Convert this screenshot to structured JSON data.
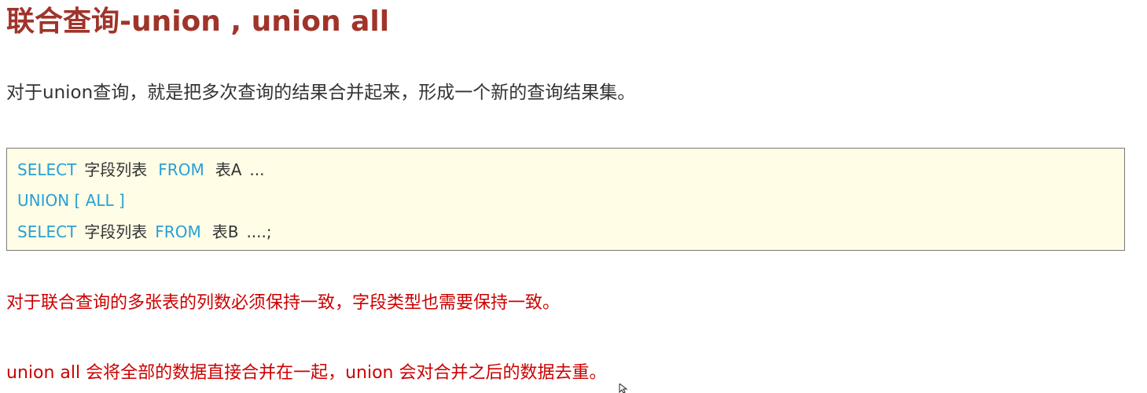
{
  "title": "联合查询-union , union all",
  "intro": "对于union查询，就是把多次查询的结果合并起来，形成一个新的查询结果集。",
  "code": {
    "line1": {
      "kw_select": "SELECT",
      "fields": "字段列表",
      "kw_from": "FROM",
      "table": "表A",
      "rest": "..."
    },
    "line2": {
      "kw_union": "UNION [ ALL ]"
    },
    "line3": {
      "kw_select": "SELECT",
      "fields": "字段列表",
      "kw_from": "FROM",
      "table": "表B",
      "rest": "....;"
    }
  },
  "notes": {
    "note1": "对于联合查询的多张表的列数必须保持一致，字段类型也需要保持一致。",
    "note2": "union all 会将全部的数据直接合并在一起，union 会对合并之后的数据去重。"
  },
  "colors": {
    "title": "#a0342a",
    "keyword": "#2a9fd6",
    "note": "#cc0000",
    "code_bg": "#fffde6"
  }
}
